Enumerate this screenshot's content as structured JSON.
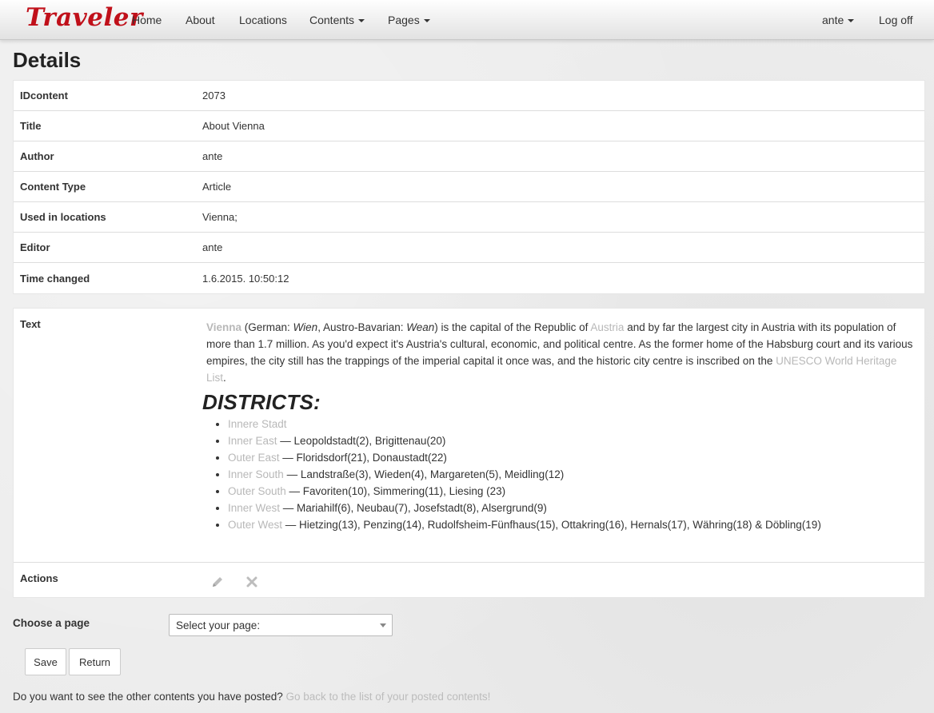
{
  "nav": {
    "brand": "Traveler",
    "items": [
      "Home",
      "About",
      "Locations",
      "Contents",
      "Pages"
    ],
    "user": "ante",
    "logoff": "Log off"
  },
  "page_title": "Details",
  "details": [
    {
      "label": "IDcontent",
      "value": "2073"
    },
    {
      "label": "Title",
      "value": "About Vienna"
    },
    {
      "label": "Author",
      "value": "ante"
    },
    {
      "label": "Content Type",
      "value": "Article"
    },
    {
      "label": "Used in locations",
      "value": "Vienna;"
    },
    {
      "label": "Editor",
      "value": "ante"
    },
    {
      "label": "Time changed",
      "value": "1.6.2015. 10:50:12"
    }
  ],
  "text_section": {
    "label": "Text",
    "intro": {
      "vienna_link": "Vienna",
      "p1": " (German: ",
      "wien": "Wien",
      "p2": ", Austro-Bavarian: ",
      "wean": "Wean",
      "p3": ") is the capital of the Republic of ",
      "austria_link": "Austria",
      "p4": " and by far the largest city in Austria with its population of more than 1.7 million. As you'd expect it's Austria's cultural, economic, and political centre. As the former home of the Habsburg court and its various empires, the city still has the trappings of the imperial capital it once was, and the historic city centre is inscribed on the ",
      "unesco_link": "UNESCO World Heritage List",
      "p5": "."
    },
    "districts_heading": "DISTRICTS:",
    "districts": [
      {
        "name": "Innere Stadt",
        "rest": ""
      },
      {
        "name": "Inner East",
        "rest": " — Leopoldstadt(2), Brigittenau(20)"
      },
      {
        "name": "Outer East",
        "rest": " — Floridsdorf(21), Donaustadt(22)"
      },
      {
        "name": "Inner South",
        "rest": " — Landstraße(3), Wieden(4), Margareten(5), Meidling(12)"
      },
      {
        "name": "Outer South",
        "rest": " — Favoriten(10), Simmering(11), Liesing (23)"
      },
      {
        "name": "Inner West",
        "rest": " — Mariahilf(6), Neubau(7), Josefstadt(8), Alsergrund(9)"
      },
      {
        "name": "Outer West",
        "rest": " — Hietzing(13), Penzing(14), Rudolfsheim-Fünfhaus(15), Ottakring(16), Hernals(17), Währing(18) & Döbling(19)"
      }
    ]
  },
  "actions": {
    "label": "Actions",
    "edit_icon": "pencil-icon",
    "delete_icon": "close-icon"
  },
  "form": {
    "choose_label": "Choose a page",
    "select_value": "Select your page:",
    "save": "Save",
    "return": "Return"
  },
  "footer": {
    "question": "Do you want to see the other contents you have posted? ",
    "link": "Go back to the list of your posted contents!"
  },
  "colors": {
    "brand": "#c0101a",
    "link_muted": "#b8b8b8"
  }
}
